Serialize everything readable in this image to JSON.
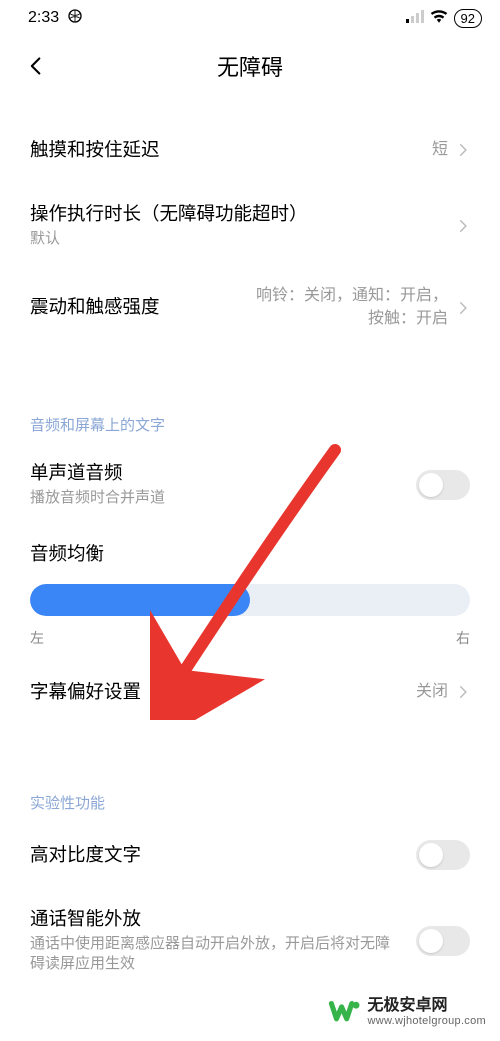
{
  "status": {
    "time": "2:33",
    "battery": "92"
  },
  "page": {
    "title": "无障碍"
  },
  "rows": {
    "touch_delay": {
      "title": "触摸和按住延迟",
      "value": "短"
    },
    "timeout": {
      "title": "操作执行时长（无障碍功能超时）",
      "sub": "默认"
    },
    "vibration": {
      "title": "震动和触感强度",
      "value": "响铃：关闭，通知：开启，按触：开启"
    },
    "mono": {
      "title": "单声道音频",
      "sub": "播放音频时合并声道"
    },
    "balance": {
      "title": "音频均衡",
      "left": "左",
      "right": "右"
    },
    "captions": {
      "title": "字幕偏好设置",
      "value": "关闭"
    },
    "contrast": {
      "title": "高对比度文字"
    },
    "speaker": {
      "title": "通话智能外放",
      "sub": "通话中使用距离感应器自动开启外放，开启后将对无障碍读屏应用生效"
    }
  },
  "sections": {
    "audio_text": "音频和屏幕上的文字",
    "experimental": "实验性功能"
  },
  "slider": {
    "fill_percent": 50
  },
  "watermark": {
    "name": "无极安卓网",
    "url": "www.wjhotelgroup.com"
  }
}
